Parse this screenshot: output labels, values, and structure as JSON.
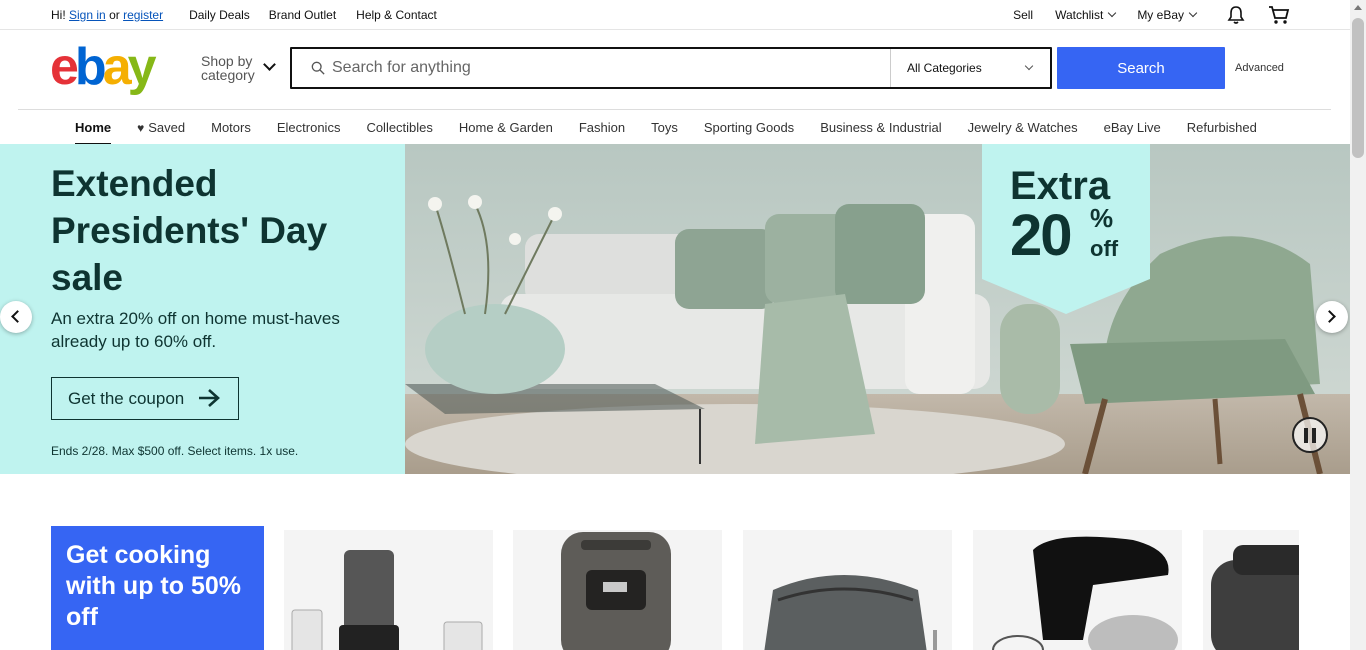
{
  "topbar": {
    "greeting": "Hi!",
    "sign_in": "Sign in",
    "or": "or",
    "register": "register",
    "links": [
      "Daily Deals",
      "Brand Outlet",
      "Help & Contact"
    ],
    "sell": "Sell",
    "watchlist": "Watchlist",
    "my_ebay": "My eBay"
  },
  "header": {
    "logo": {
      "e": "e",
      "b": "b",
      "a": "a",
      "y": "y"
    },
    "shop_by_1": "Shop by",
    "shop_by_2": "category",
    "search_placeholder": "Search for anything",
    "category": "All Categories",
    "search_button": "Search",
    "advanced": "Advanced"
  },
  "nav": {
    "items": [
      "Home",
      "Saved",
      "Motors",
      "Electronics",
      "Collectibles",
      "Home & Garden",
      "Fashion",
      "Toys",
      "Sporting Goods",
      "Business & Industrial",
      "Jewelry & Watches",
      "eBay Live",
      "Refurbished"
    ]
  },
  "hero": {
    "title": "Extended Presidents' Day sale",
    "subtitle": "An extra 20% off on home must-haves already up to 60% off.",
    "cta": "Get the coupon",
    "fine_print": "Ends 2/28. Max $500 off. Select items. 1x use.",
    "badge_line1": "Extra",
    "badge_num": "20",
    "badge_pct": "%",
    "badge_off": "off"
  },
  "promo": {
    "text": "Get cooking with up to 50% off"
  },
  "colors": {
    "accent": "#3665f3",
    "hero_panel": "#bff3ef",
    "hero_text": "#0e3431"
  }
}
